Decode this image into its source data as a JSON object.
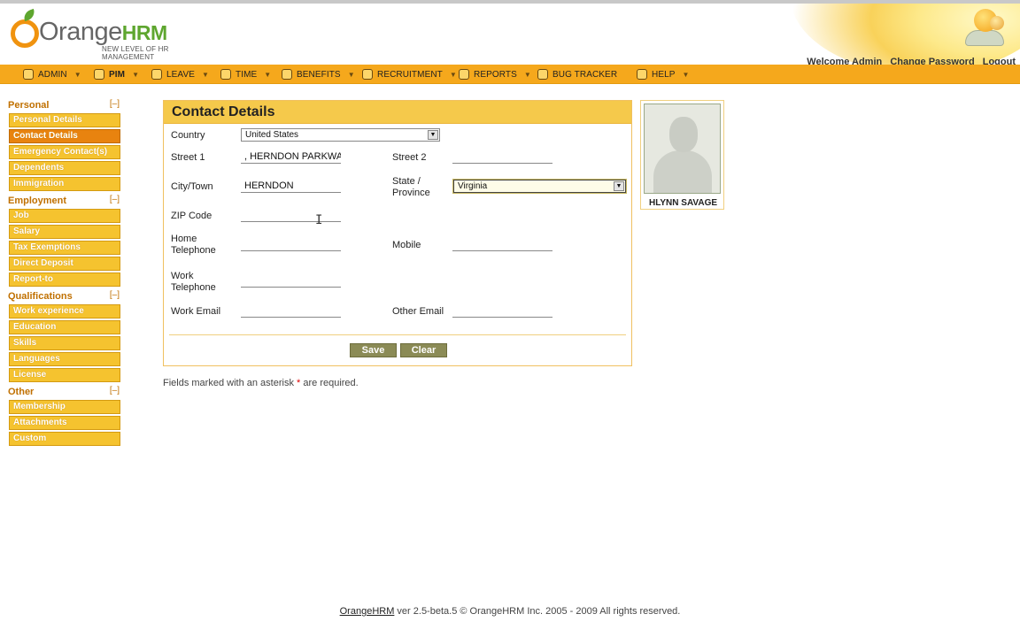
{
  "header": {
    "brand_orange": "Orange",
    "brand_hrm": "HRM",
    "tagline": "NEW LEVEL OF HR MANAGEMENT",
    "welcome": "Welcome Admin",
    "change_password": "Change Password",
    "logout": "Logout"
  },
  "menu": [
    {
      "label": "Admin",
      "icon": "admin-icon"
    },
    {
      "label": "PIM",
      "icon": "pim-icon"
    },
    {
      "label": "Leave",
      "icon": "leave-icon"
    },
    {
      "label": "Time",
      "icon": "time-icon"
    },
    {
      "label": "Benefits",
      "icon": "benefits-icon"
    },
    {
      "label": "Recruitment",
      "icon": "recruitment-icon"
    },
    {
      "label": "Reports",
      "icon": "reports-icon"
    },
    {
      "label": "Bug Tracker",
      "icon": "bug-tracker-icon"
    },
    {
      "label": "Help",
      "icon": "help-icon"
    }
  ],
  "sidebar": {
    "collapse_glyph": "[–]",
    "personal": {
      "title": "Personal",
      "items": [
        "Personal Details",
        "Contact Details",
        "Emergency Contact(s)",
        "Dependents",
        "Immigration"
      ]
    },
    "employment": {
      "title": "Employment",
      "items": [
        "Job",
        "Salary",
        "Tax Exemptions",
        "Direct Deposit",
        "Report-to"
      ]
    },
    "qualifications": {
      "title": "Qualifications",
      "items": [
        "Work experience",
        "Education",
        "Skills",
        "Languages",
        "License"
      ]
    },
    "other": {
      "title": "Other",
      "items": [
        "Membership",
        "Attachments",
        "Custom"
      ]
    }
  },
  "form": {
    "title": "Contact Details",
    "labels": {
      "country": "Country",
      "street1": "Street 1",
      "street2": "Street 2",
      "city": "City/Town",
      "state_line1": "State /",
      "state_line2": "Province",
      "zip": "ZIP Code",
      "home_tel_line1": "Home",
      "home_tel_line2": "Telephone",
      "mobile": "Mobile",
      "work_tel_line1": "Work",
      "work_tel_line2": "Telephone",
      "work_email": "Work Email",
      "other_email": "Other Email"
    },
    "values": {
      "country": "United States",
      "street1": ", HERNDON PARKWAY",
      "street2": "",
      "city": "HERNDON",
      "state": "Virginia",
      "zip": "",
      "home_tel": "",
      "mobile": "",
      "work_tel": "",
      "work_email": "",
      "other_email": ""
    },
    "save": "Save",
    "clear": "Clear"
  },
  "note": {
    "before": "Fields marked with an asterisk",
    "star": "*",
    "after": "are required."
  },
  "photo": {
    "name": "HLYNN SAVAGE"
  },
  "footer": {
    "link": "OrangeHRM",
    "text": " ver 2.5-beta.5 © OrangeHRM Inc. 2005 - 2009 All rights reserved."
  },
  "colors": {
    "menu_bar": "#f5a81c",
    "panel_title": "#f5c94b",
    "sidebar_item": "#f5c32f",
    "sidebar_active": "#e8830f",
    "button": "#8b8b56"
  }
}
